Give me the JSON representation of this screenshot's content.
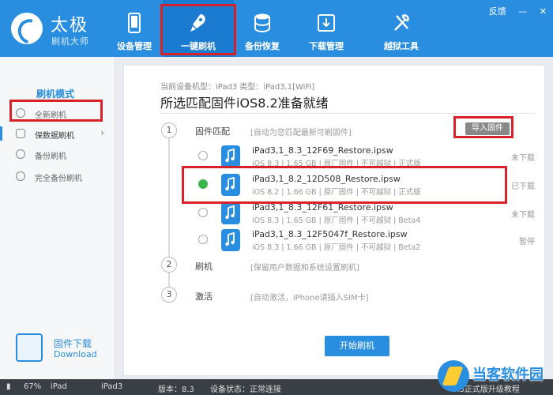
{
  "app": {
    "title": "太极",
    "subtitle": "刷机大师"
  },
  "top_links": {
    "feedback": "反馈",
    "minimize": "—",
    "close": "✕"
  },
  "nav": [
    {
      "label": "设备管理",
      "icon": "phone-icon"
    },
    {
      "label": "一键刷机",
      "icon": "rocket-icon",
      "active": true
    },
    {
      "label": "备份恢复",
      "icon": "database-icon"
    },
    {
      "label": "下载管理",
      "icon": "download-box-icon"
    },
    {
      "label": "越狱工具",
      "icon": "tools-icon"
    }
  ],
  "sidebar": {
    "title": "刷机模式",
    "items": [
      {
        "label": "全新刷机",
        "icon": "clean-flash-icon"
      },
      {
        "label": "保数据刷机",
        "icon": "keep-data-icon",
        "arrow": "›"
      },
      {
        "label": "备份刷机",
        "icon": "backup-icon"
      },
      {
        "label": "完全备份刷机",
        "icon": "full-backup-icon"
      }
    ],
    "download": {
      "title": "固件下载",
      "subtitle": "Download"
    }
  },
  "main": {
    "device_info": "当前设备机型：iPad3 类型：iPad3,1[WiFi]",
    "ready_title": "所选匹配固件iOS8.2准备就绪",
    "steps": [
      {
        "num": "1",
        "label": "固件匹配",
        "hint": "[自动为您匹配最新可刷固件]"
      },
      {
        "num": "2",
        "label": "刷机",
        "hint": "[保留用户数据和系统设置刷机]"
      },
      {
        "num": "3",
        "label": "激活",
        "hint": "[自动激活，iPhone请插入SIM卡]"
      }
    ],
    "import_label": "导入固件",
    "firmwares": [
      {
        "name": "iPad3,1_8.3_12F69_Restore.ipsw",
        "meta": "iOS 8.3 | 1.65 GB | 原厂固件 | 不可越狱 | 正式版",
        "status": "未下载",
        "selected": false
      },
      {
        "name": "iPad3,1_8.2_12D508_Restore.ipsw",
        "meta": "iOS 8.2 | 1.66 GB | 原厂固件 | 不可越狱 | 正式版",
        "status": "已下载",
        "selected": true
      },
      {
        "name": "iPad3,1_8.3_12F61_Restore.ipsw",
        "meta": "iOS 8.3 | 1.65 GB | 原厂固件 | 不可越狱 | Beta4",
        "status": "未下载",
        "selected": false
      },
      {
        "name": "iPad3,1_8.3_12F5047f_Restore.ipsw",
        "meta": "iOS 8.3 | 1.66 GB | 原厂固件 | 不可越狱 | Beta2",
        "status": "暂停",
        "selected": false
      }
    ],
    "start_label": "开始刷机"
  },
  "statusbar": {
    "battery": "67%",
    "device": "iPad",
    "model": "iPad3",
    "version": "版本：8.3",
    "state": "设备状态：正常连接",
    "right": "8.3正式版升级教程"
  },
  "watermark": {
    "text": "当客软件园"
  },
  "colors": {
    "accent": "#2a8ee0",
    "highlight": "#d62228",
    "selected": "#3bb54a"
  }
}
